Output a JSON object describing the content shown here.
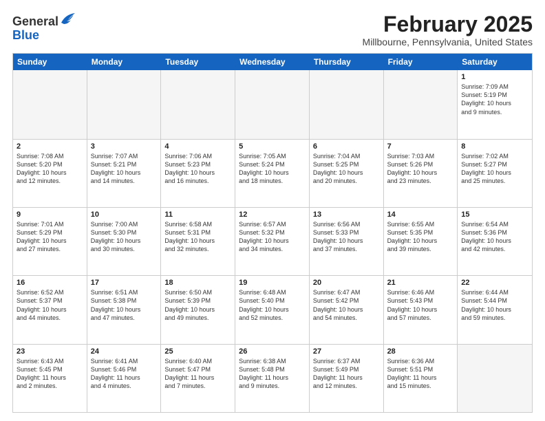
{
  "logo": {
    "general": "General",
    "blue": "Blue"
  },
  "header": {
    "month": "February 2025",
    "location": "Millbourne, Pennsylvania, United States"
  },
  "weekdays": [
    "Sunday",
    "Monday",
    "Tuesday",
    "Wednesday",
    "Thursday",
    "Friday",
    "Saturday"
  ],
  "weeks": [
    [
      {
        "day": "",
        "info": "",
        "empty": true
      },
      {
        "day": "",
        "info": "",
        "empty": true
      },
      {
        "day": "",
        "info": "",
        "empty": true
      },
      {
        "day": "",
        "info": "",
        "empty": true
      },
      {
        "day": "",
        "info": "",
        "empty": true
      },
      {
        "day": "",
        "info": "",
        "empty": true
      },
      {
        "day": "1",
        "info": "Sunrise: 7:09 AM\nSunset: 5:19 PM\nDaylight: 10 hours\nand 9 minutes.",
        "empty": false
      }
    ],
    [
      {
        "day": "2",
        "info": "Sunrise: 7:08 AM\nSunset: 5:20 PM\nDaylight: 10 hours\nand 12 minutes.",
        "empty": false
      },
      {
        "day": "3",
        "info": "Sunrise: 7:07 AM\nSunset: 5:21 PM\nDaylight: 10 hours\nand 14 minutes.",
        "empty": false
      },
      {
        "day": "4",
        "info": "Sunrise: 7:06 AM\nSunset: 5:23 PM\nDaylight: 10 hours\nand 16 minutes.",
        "empty": false
      },
      {
        "day": "5",
        "info": "Sunrise: 7:05 AM\nSunset: 5:24 PM\nDaylight: 10 hours\nand 18 minutes.",
        "empty": false
      },
      {
        "day": "6",
        "info": "Sunrise: 7:04 AM\nSunset: 5:25 PM\nDaylight: 10 hours\nand 20 minutes.",
        "empty": false
      },
      {
        "day": "7",
        "info": "Sunrise: 7:03 AM\nSunset: 5:26 PM\nDaylight: 10 hours\nand 23 minutes.",
        "empty": false
      },
      {
        "day": "8",
        "info": "Sunrise: 7:02 AM\nSunset: 5:27 PM\nDaylight: 10 hours\nand 25 minutes.",
        "empty": false
      }
    ],
    [
      {
        "day": "9",
        "info": "Sunrise: 7:01 AM\nSunset: 5:29 PM\nDaylight: 10 hours\nand 27 minutes.",
        "empty": false
      },
      {
        "day": "10",
        "info": "Sunrise: 7:00 AM\nSunset: 5:30 PM\nDaylight: 10 hours\nand 30 minutes.",
        "empty": false
      },
      {
        "day": "11",
        "info": "Sunrise: 6:58 AM\nSunset: 5:31 PM\nDaylight: 10 hours\nand 32 minutes.",
        "empty": false
      },
      {
        "day": "12",
        "info": "Sunrise: 6:57 AM\nSunset: 5:32 PM\nDaylight: 10 hours\nand 34 minutes.",
        "empty": false
      },
      {
        "day": "13",
        "info": "Sunrise: 6:56 AM\nSunset: 5:33 PM\nDaylight: 10 hours\nand 37 minutes.",
        "empty": false
      },
      {
        "day": "14",
        "info": "Sunrise: 6:55 AM\nSunset: 5:35 PM\nDaylight: 10 hours\nand 39 minutes.",
        "empty": false
      },
      {
        "day": "15",
        "info": "Sunrise: 6:54 AM\nSunset: 5:36 PM\nDaylight: 10 hours\nand 42 minutes.",
        "empty": false
      }
    ],
    [
      {
        "day": "16",
        "info": "Sunrise: 6:52 AM\nSunset: 5:37 PM\nDaylight: 10 hours\nand 44 minutes.",
        "empty": false
      },
      {
        "day": "17",
        "info": "Sunrise: 6:51 AM\nSunset: 5:38 PM\nDaylight: 10 hours\nand 47 minutes.",
        "empty": false
      },
      {
        "day": "18",
        "info": "Sunrise: 6:50 AM\nSunset: 5:39 PM\nDaylight: 10 hours\nand 49 minutes.",
        "empty": false
      },
      {
        "day": "19",
        "info": "Sunrise: 6:48 AM\nSunset: 5:40 PM\nDaylight: 10 hours\nand 52 minutes.",
        "empty": false
      },
      {
        "day": "20",
        "info": "Sunrise: 6:47 AM\nSunset: 5:42 PM\nDaylight: 10 hours\nand 54 minutes.",
        "empty": false
      },
      {
        "day": "21",
        "info": "Sunrise: 6:46 AM\nSunset: 5:43 PM\nDaylight: 10 hours\nand 57 minutes.",
        "empty": false
      },
      {
        "day": "22",
        "info": "Sunrise: 6:44 AM\nSunset: 5:44 PM\nDaylight: 10 hours\nand 59 minutes.",
        "empty": false
      }
    ],
    [
      {
        "day": "23",
        "info": "Sunrise: 6:43 AM\nSunset: 5:45 PM\nDaylight: 11 hours\nand 2 minutes.",
        "empty": false
      },
      {
        "day": "24",
        "info": "Sunrise: 6:41 AM\nSunset: 5:46 PM\nDaylight: 11 hours\nand 4 minutes.",
        "empty": false
      },
      {
        "day": "25",
        "info": "Sunrise: 6:40 AM\nSunset: 5:47 PM\nDaylight: 11 hours\nand 7 minutes.",
        "empty": false
      },
      {
        "day": "26",
        "info": "Sunrise: 6:38 AM\nSunset: 5:48 PM\nDaylight: 11 hours\nand 9 minutes.",
        "empty": false
      },
      {
        "day": "27",
        "info": "Sunrise: 6:37 AM\nSunset: 5:49 PM\nDaylight: 11 hours\nand 12 minutes.",
        "empty": false
      },
      {
        "day": "28",
        "info": "Sunrise: 6:36 AM\nSunset: 5:51 PM\nDaylight: 11 hours\nand 15 minutes.",
        "empty": false
      },
      {
        "day": "",
        "info": "",
        "empty": true
      }
    ]
  ]
}
